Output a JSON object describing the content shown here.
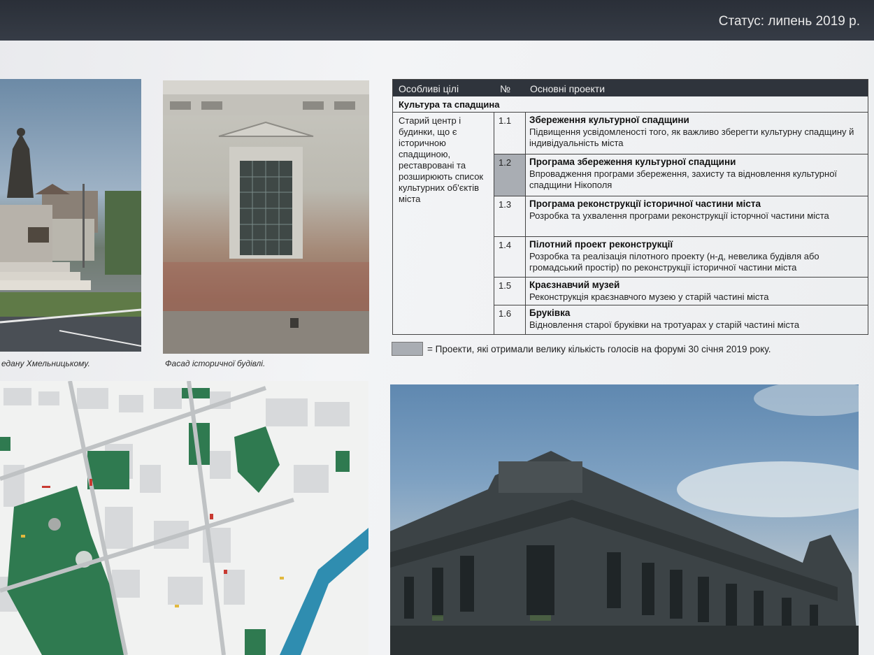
{
  "header": {
    "status": "Статус: липень 2019 р."
  },
  "photos": {
    "monument_caption": "едану Хмельницькому.",
    "facade_caption": "Фасад історичної будівлі."
  },
  "table": {
    "columns": [
      "Особливі цілі",
      "№",
      "Основні проекти"
    ],
    "section": "Культура та спадщина",
    "goal": "Старий центр і будинки, що є історичною спадщиною, реставровані та розширюють список культурних об'єктів міста",
    "projects": [
      {
        "num": "1.1",
        "title": "Збереження культурної спадщини",
        "description": "Підвищення усвідомленості того, як важливо зберегти культурну спадщину й індивідуальність міста",
        "highlighted": false
      },
      {
        "num": "1.2",
        "title": "Програма збереження культурної спадщини",
        "description": "Впровадження програми збереження, захисту та відновлення культурної спадщини Нікополя",
        "highlighted": true
      },
      {
        "num": "1.3",
        "title": "Програма реконструкції історичної частини міста",
        "description": "Розробка та ухвалення програми реконструкції історчної частини міста",
        "highlighted": false
      },
      {
        "num": "1.4",
        "title": "Пілотний проект реконструкції",
        "description": "Розробка та реалізація пілотного проекту (н-д, невелика будівля або громадський простір) по реконструкції історичної частини міста",
        "highlighted": false
      },
      {
        "num": "1.5",
        "title": "Краєзнавчий музей",
        "description": "Реконструкція краєзнавчого музею у старій частині міста",
        "highlighted": false
      },
      {
        "num": "1.6",
        "title": "Бруківка",
        "description": "Відновлення старої бруківки на тротуарах у старій частині міста",
        "highlighted": false
      }
    ]
  },
  "legend": {
    "text": "= Проекти, які отримали велику кількість голосів на форумі 30 січня 2019 року.",
    "swatch_color": "#a9adb3"
  }
}
